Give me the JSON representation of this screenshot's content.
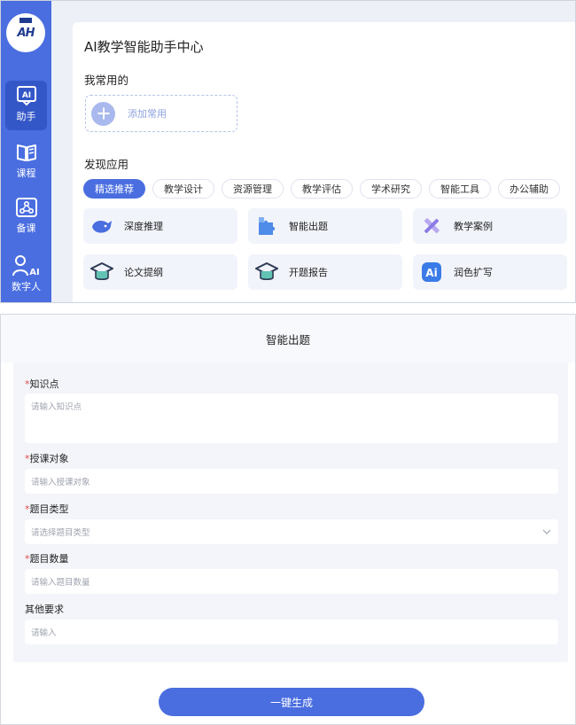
{
  "logo": {
    "text": "AH"
  },
  "sidebar": {
    "items": [
      {
        "label": "助手",
        "active": true,
        "icon": "ai-assistant-icon"
      },
      {
        "label": "课程",
        "active": false,
        "icon": "book-icon"
      },
      {
        "label": "备课",
        "active": false,
        "icon": "network-icon"
      },
      {
        "label": "数字人",
        "active": false,
        "icon": "digital-human-icon"
      }
    ]
  },
  "main": {
    "title": "AI教学智能助手中心",
    "favorites": {
      "heading": "我常用的",
      "add_label": "添加常用"
    },
    "discover": {
      "heading": "发现应用",
      "categories": [
        "精选推荐",
        "教学设计",
        "资源管理",
        "教学评估",
        "学术研究",
        "智能工具",
        "办公辅助"
      ],
      "active_category": "精选推荐",
      "apps": [
        {
          "label": "深度推理",
          "icon": "whale-icon"
        },
        {
          "label": "智能出题",
          "icon": "puzzle-icon"
        },
        {
          "label": "教学案例",
          "icon": "ruler-pencil-icon"
        },
        {
          "label": "论文提纲",
          "icon": "graduation-cap-icon"
        },
        {
          "label": "开题报告",
          "icon": "graduation-cap-icon"
        },
        {
          "label": "润色扩写",
          "icon": "ai-badge-icon"
        }
      ]
    }
  },
  "form": {
    "title": "智能出题",
    "fields": [
      {
        "label": "知识点",
        "required": true,
        "placeholder": "请输入知识点"
      },
      {
        "label": "授课对象",
        "required": true,
        "placeholder": "请输入授课对象"
      },
      {
        "label": "题目类型",
        "required": true,
        "placeholder": "请选择题目类型"
      },
      {
        "label": "题目数量",
        "required": true,
        "placeholder": "请输入题目数量"
      },
      {
        "label": "其他要求",
        "required": false,
        "placeholder": "请输入"
      }
    ],
    "required_mark": "*",
    "submit_label": "一键生成"
  },
  "colors": {
    "primary": "#4a6ee0",
    "sidebar_active": "#3457c8",
    "required": "#e24b4b",
    "placeholder": "#9ea3ae",
    "app_card_bg": "#f2f4fb"
  }
}
